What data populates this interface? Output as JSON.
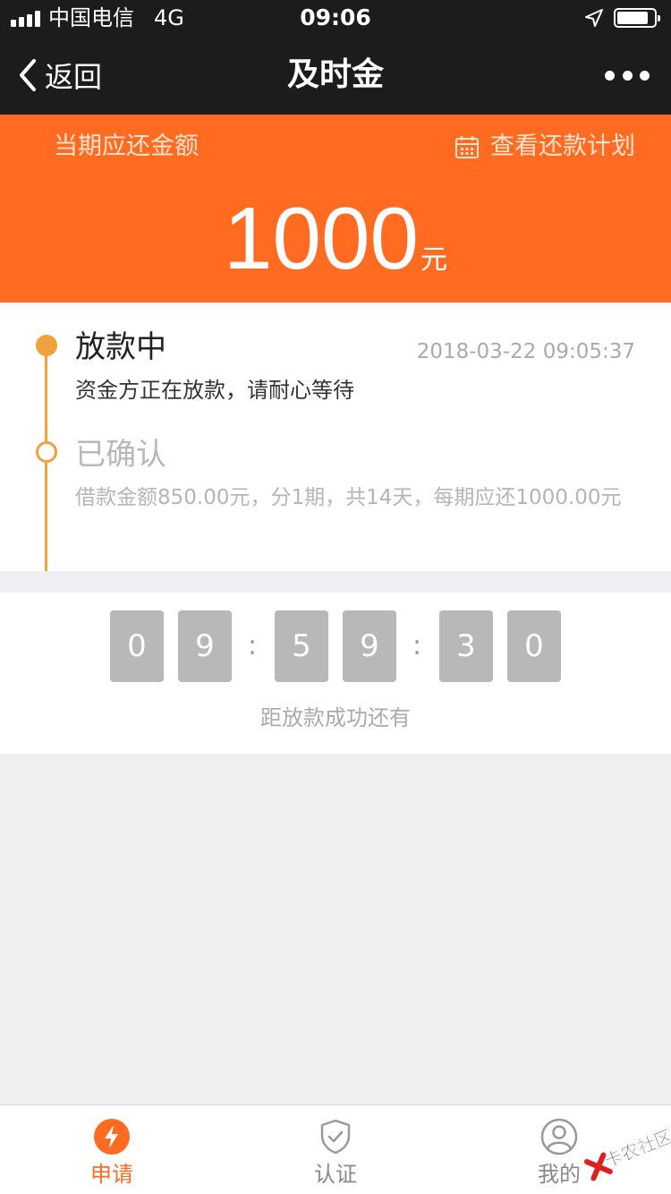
{
  "status_bar": {
    "carrier": "中国电信",
    "network": "4G",
    "time": "09:06",
    "signal_icon": "signal-bars-icon",
    "location_icon": "location-arrow-icon",
    "battery_icon": "battery-icon",
    "battery_level": 0.85
  },
  "nav": {
    "back_label": "返回",
    "title": "及时金",
    "more_icon": "more-dots-icon"
  },
  "banner": {
    "label": "当期应还金额",
    "plan_label": "查看还款计划",
    "plan_icon": "calendar-icon",
    "amount": "1000",
    "unit": "元",
    "background_color": "#ff6b21"
  },
  "timeline": {
    "accent_color": "#f2a23c",
    "steps": [
      {
        "title": "放款中",
        "time": "2018-03-22 09:05:37",
        "description": "资金方正在放款，请耐心等待"
      },
      {
        "title": "已确认",
        "description": "借款金额850.00元，分1期，共14天，每期应还1000.00元"
      }
    ]
  },
  "countdown": {
    "digits": [
      "0",
      "9",
      "5",
      "9",
      "3",
      "0"
    ],
    "separator": ":",
    "caption": "距放款成功还有"
  },
  "tabbar": {
    "tabs": [
      {
        "label": "申请",
        "icon": "lightning-icon",
        "active": true
      },
      {
        "label": "认证",
        "icon": "shield-check-icon",
        "active": false
      },
      {
        "label": "我的",
        "icon": "user-icon",
        "active": false
      }
    ],
    "active_color": "#ff6b21"
  },
  "watermark": {
    "text": "卡农社区",
    "icon": "kanong-logo-icon"
  }
}
